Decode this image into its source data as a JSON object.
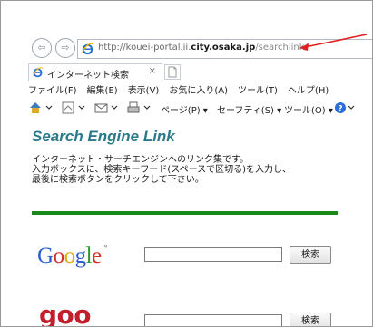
{
  "browser": {
    "url_prefix": "http://kouei-portal.ii.",
    "url_domain": "city.osaka.jp",
    "url_suffix": "/searchlink/",
    "tab_title": "インターネット検索",
    "tab_close": "×"
  },
  "menu": [
    "ファイル(F)",
    "編集(E)",
    "表示(V)",
    "お気に入り(A)",
    "ツール(T)",
    "ヘルプ(H)"
  ],
  "commandbar": {
    "page": "ページ(P) ▾",
    "safety": "セーフティ(S) ▾",
    "tools": "ツール(O) ▾"
  },
  "page": {
    "title": "Search Engine Link",
    "intro": [
      "インターネット・サーチエンジンへのリンク集です。",
      "入力ボックスに、検索キーワード(スペースで区切る)を入力し、",
      "最後に検索ボタンをクリックして下さい。"
    ],
    "engines": [
      {
        "name": "Google",
        "button": "検索",
        "value": ""
      },
      {
        "name": "goo",
        "button": "検索",
        "value": ""
      }
    ]
  },
  "colors": {
    "divider": "#178a1a",
    "title": "#2a7a8c",
    "arrow": "#e02020"
  }
}
